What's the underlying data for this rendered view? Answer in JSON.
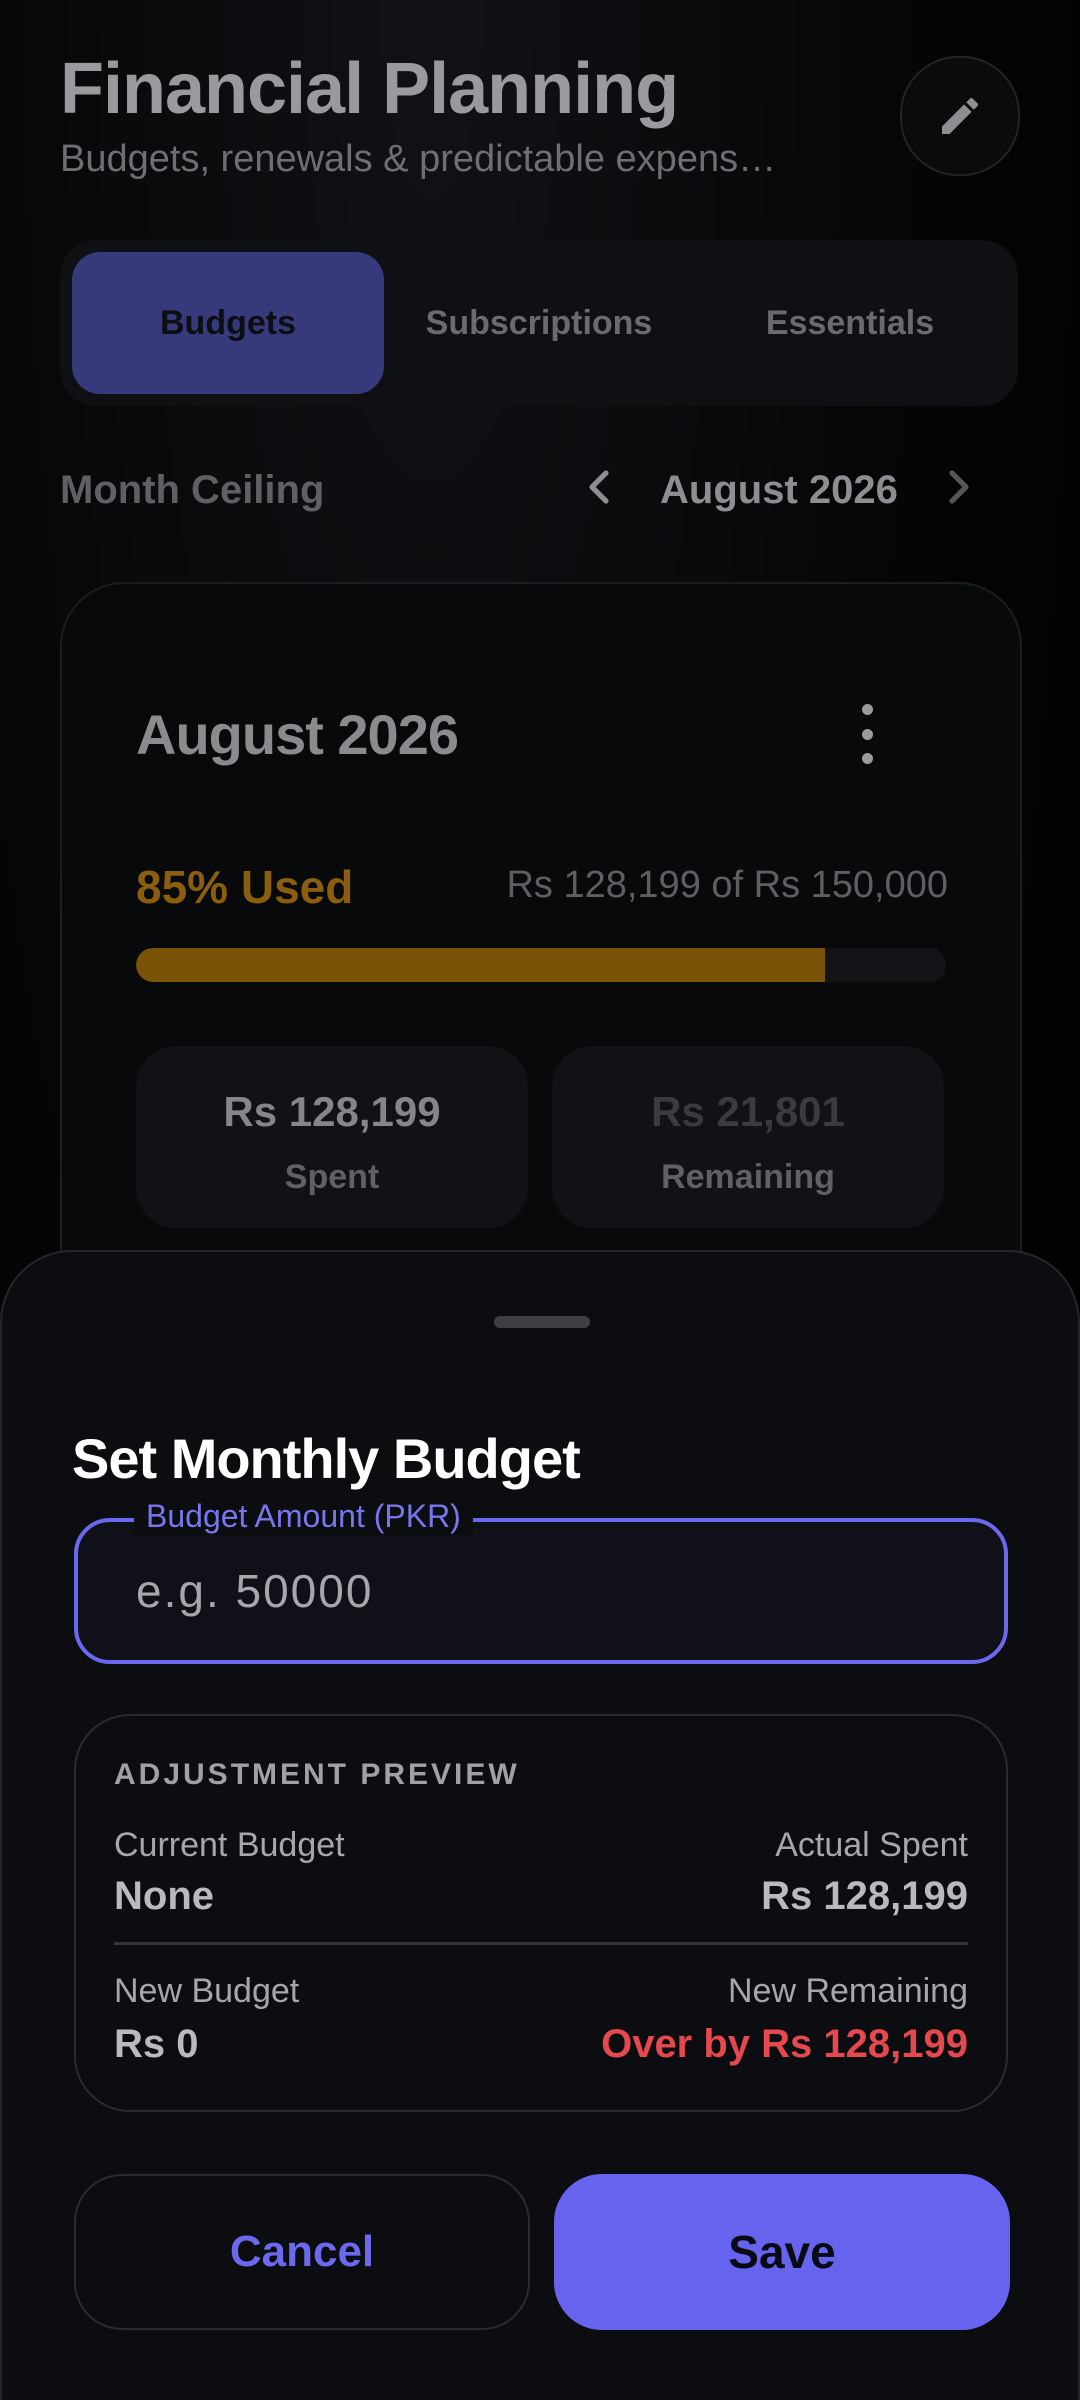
{
  "header": {
    "title": "Financial Planning",
    "subtitle": "Budgets, renewals & predictable expens…",
    "edit_icon": "pencil-icon"
  },
  "tabs": [
    {
      "label": "Budgets",
      "active": true
    },
    {
      "label": "Subscriptions",
      "active": false
    },
    {
      "label": "Essentials",
      "active": false
    }
  ],
  "month_row": {
    "label": "Month Ceiling",
    "current_month": "August 2026",
    "prev_icon": "chevron-left-icon",
    "next_icon": "chevron-right-icon"
  },
  "budget_card": {
    "title": "August 2026",
    "menu_icon": "more-vertical-icon",
    "used_label": "85% Used",
    "used_fraction": 0.85,
    "amount_summary": "Rs 128,199 of Rs 150,000",
    "spent_value": "Rs 128,199",
    "spent_label": "Spent",
    "remaining_value": "Rs 21,801",
    "remaining_label": "Remaining",
    "colors": {
      "progress": "#7a5208",
      "used_text": "#8a5e0e"
    }
  },
  "sheet": {
    "title": "Set Monthly Budget",
    "field_label": "Budget Amount (PKR)",
    "field_placeholder": "e.g. 50000",
    "field_value": "",
    "preview": {
      "heading": "ADJUSTMENT PREVIEW",
      "current_budget_label": "Current Budget",
      "current_budget_value": "None",
      "actual_spent_label": "Actual Spent",
      "actual_spent_value": "Rs 128,199",
      "new_budget_label": "New Budget",
      "new_budget_value": "Rs 0",
      "new_remaining_label": "New Remaining",
      "new_remaining_value": "Over by Rs 128,199"
    },
    "cancel_label": "Cancel",
    "save_label": "Save",
    "colors": {
      "accent": "#6664ee",
      "danger": "#e5484d"
    }
  }
}
